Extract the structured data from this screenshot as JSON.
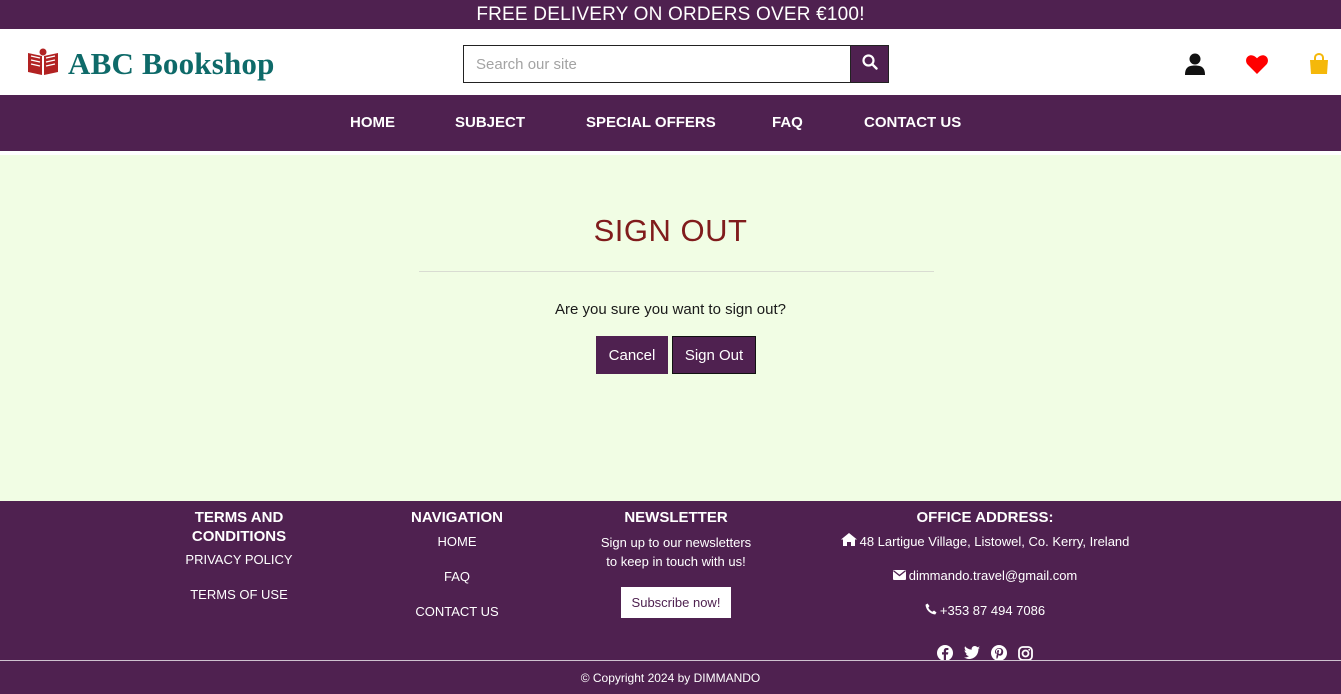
{
  "banner": {
    "text": "FREE DELIVERY ON ORDERS OVER €100!"
  },
  "header": {
    "logo_text": "ABC Bookshop",
    "search_placeholder": "Search our site",
    "icons": [
      "user-icon",
      "heart-icon",
      "shopping-bag-icon"
    ]
  },
  "nav": {
    "items": [
      {
        "label": "HOME"
      },
      {
        "label": "SUBJECT"
      },
      {
        "label": "SPECIAL OFFERS"
      },
      {
        "label": "FAQ"
      },
      {
        "label": "CONTACT US"
      }
    ]
  },
  "main": {
    "title": "SIGN OUT",
    "question": "Are you sure you want to sign out?",
    "cancel_label": "Cancel",
    "signout_label": "Sign Out"
  },
  "footer": {
    "terms": {
      "heading_line1": "TERMS AND",
      "heading_line2": "CONDITIONS",
      "links": [
        "PRIVACY POLICY",
        "TERMS OF USE"
      ]
    },
    "navigation": {
      "heading": "NAVIGATION",
      "links": [
        "HOME",
        "FAQ",
        "CONTACT US"
      ]
    },
    "newsletter": {
      "heading": "NEWSLETTER",
      "text_line1": "Sign up to our newsletters",
      "text_line2": "to keep in touch with us!",
      "button_label": "Subscribe now!"
    },
    "office": {
      "heading": "OFFICE ADDRESS:",
      "address": "48 Lartigue Village, Listowel, Co. Kerry, Ireland",
      "email": "dimmando.travel@gmail.com",
      "phone": "+353 87 494 7086",
      "social_icons": [
        "facebook-icon",
        "twitter-icon",
        "pinterest-icon",
        "instagram-icon"
      ]
    },
    "copyright": "© Copyright 2024 by DIMMANDO"
  },
  "colors": {
    "brand_purple": "#4f2150",
    "logo_teal": "#0e6a69",
    "title_red": "#801c1c",
    "page_bg": "#f1fde4",
    "heart_red": "#ff0000",
    "bag_yellow": "#f5b80a"
  }
}
